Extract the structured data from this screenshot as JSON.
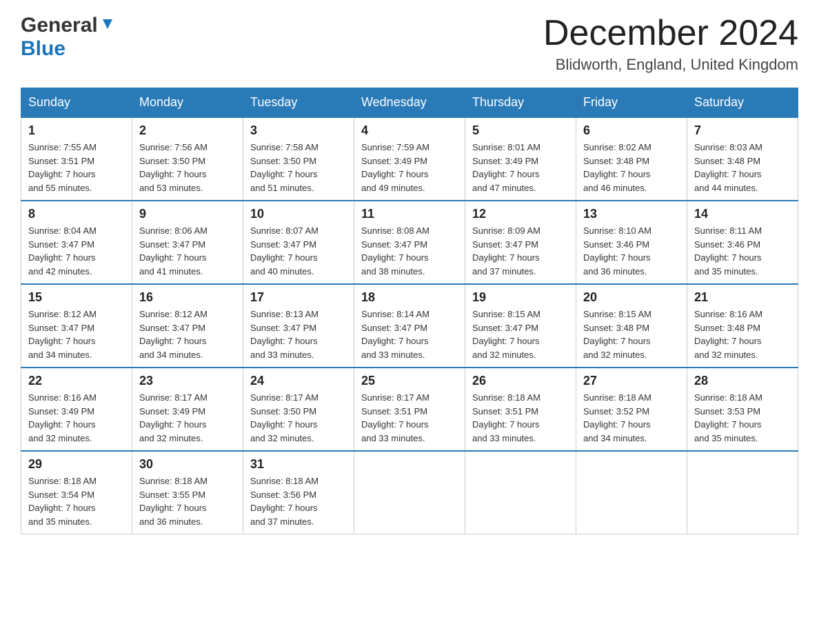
{
  "header": {
    "logo_general": "General",
    "logo_blue": "Blue",
    "month_title": "December 2024",
    "location": "Blidworth, England, United Kingdom"
  },
  "days_of_week": [
    "Sunday",
    "Monday",
    "Tuesday",
    "Wednesday",
    "Thursday",
    "Friday",
    "Saturday"
  ],
  "weeks": [
    [
      {
        "day": "1",
        "sunrise": "7:55 AM",
        "sunset": "3:51 PM",
        "daylight": "7 hours and 55 minutes."
      },
      {
        "day": "2",
        "sunrise": "7:56 AM",
        "sunset": "3:50 PM",
        "daylight": "7 hours and 53 minutes."
      },
      {
        "day": "3",
        "sunrise": "7:58 AM",
        "sunset": "3:50 PM",
        "daylight": "7 hours and 51 minutes."
      },
      {
        "day": "4",
        "sunrise": "7:59 AM",
        "sunset": "3:49 PM",
        "daylight": "7 hours and 49 minutes."
      },
      {
        "day": "5",
        "sunrise": "8:01 AM",
        "sunset": "3:49 PM",
        "daylight": "7 hours and 47 minutes."
      },
      {
        "day": "6",
        "sunrise": "8:02 AM",
        "sunset": "3:48 PM",
        "daylight": "7 hours and 46 minutes."
      },
      {
        "day": "7",
        "sunrise": "8:03 AM",
        "sunset": "3:48 PM",
        "daylight": "7 hours and 44 minutes."
      }
    ],
    [
      {
        "day": "8",
        "sunrise": "8:04 AM",
        "sunset": "3:47 PM",
        "daylight": "7 hours and 42 minutes."
      },
      {
        "day": "9",
        "sunrise": "8:06 AM",
        "sunset": "3:47 PM",
        "daylight": "7 hours and 41 minutes."
      },
      {
        "day": "10",
        "sunrise": "8:07 AM",
        "sunset": "3:47 PM",
        "daylight": "7 hours and 40 minutes."
      },
      {
        "day": "11",
        "sunrise": "8:08 AM",
        "sunset": "3:47 PM",
        "daylight": "7 hours and 38 minutes."
      },
      {
        "day": "12",
        "sunrise": "8:09 AM",
        "sunset": "3:47 PM",
        "daylight": "7 hours and 37 minutes."
      },
      {
        "day": "13",
        "sunrise": "8:10 AM",
        "sunset": "3:46 PM",
        "daylight": "7 hours and 36 minutes."
      },
      {
        "day": "14",
        "sunrise": "8:11 AM",
        "sunset": "3:46 PM",
        "daylight": "7 hours and 35 minutes."
      }
    ],
    [
      {
        "day": "15",
        "sunrise": "8:12 AM",
        "sunset": "3:47 PM",
        "daylight": "7 hours and 34 minutes."
      },
      {
        "day": "16",
        "sunrise": "8:12 AM",
        "sunset": "3:47 PM",
        "daylight": "7 hours and 34 minutes."
      },
      {
        "day": "17",
        "sunrise": "8:13 AM",
        "sunset": "3:47 PM",
        "daylight": "7 hours and 33 minutes."
      },
      {
        "day": "18",
        "sunrise": "8:14 AM",
        "sunset": "3:47 PM",
        "daylight": "7 hours and 33 minutes."
      },
      {
        "day": "19",
        "sunrise": "8:15 AM",
        "sunset": "3:47 PM",
        "daylight": "7 hours and 32 minutes."
      },
      {
        "day": "20",
        "sunrise": "8:15 AM",
        "sunset": "3:48 PM",
        "daylight": "7 hours and 32 minutes."
      },
      {
        "day": "21",
        "sunrise": "8:16 AM",
        "sunset": "3:48 PM",
        "daylight": "7 hours and 32 minutes."
      }
    ],
    [
      {
        "day": "22",
        "sunrise": "8:16 AM",
        "sunset": "3:49 PM",
        "daylight": "7 hours and 32 minutes."
      },
      {
        "day": "23",
        "sunrise": "8:17 AM",
        "sunset": "3:49 PM",
        "daylight": "7 hours and 32 minutes."
      },
      {
        "day": "24",
        "sunrise": "8:17 AM",
        "sunset": "3:50 PM",
        "daylight": "7 hours and 32 minutes."
      },
      {
        "day": "25",
        "sunrise": "8:17 AM",
        "sunset": "3:51 PM",
        "daylight": "7 hours and 33 minutes."
      },
      {
        "day": "26",
        "sunrise": "8:18 AM",
        "sunset": "3:51 PM",
        "daylight": "7 hours and 33 minutes."
      },
      {
        "day": "27",
        "sunrise": "8:18 AM",
        "sunset": "3:52 PM",
        "daylight": "7 hours and 34 minutes."
      },
      {
        "day": "28",
        "sunrise": "8:18 AM",
        "sunset": "3:53 PM",
        "daylight": "7 hours and 35 minutes."
      }
    ],
    [
      {
        "day": "29",
        "sunrise": "8:18 AM",
        "sunset": "3:54 PM",
        "daylight": "7 hours and 35 minutes."
      },
      {
        "day": "30",
        "sunrise": "8:18 AM",
        "sunset": "3:55 PM",
        "daylight": "7 hours and 36 minutes."
      },
      {
        "day": "31",
        "sunrise": "8:18 AM",
        "sunset": "3:56 PM",
        "daylight": "7 hours and 37 minutes."
      },
      null,
      null,
      null,
      null
    ]
  ]
}
